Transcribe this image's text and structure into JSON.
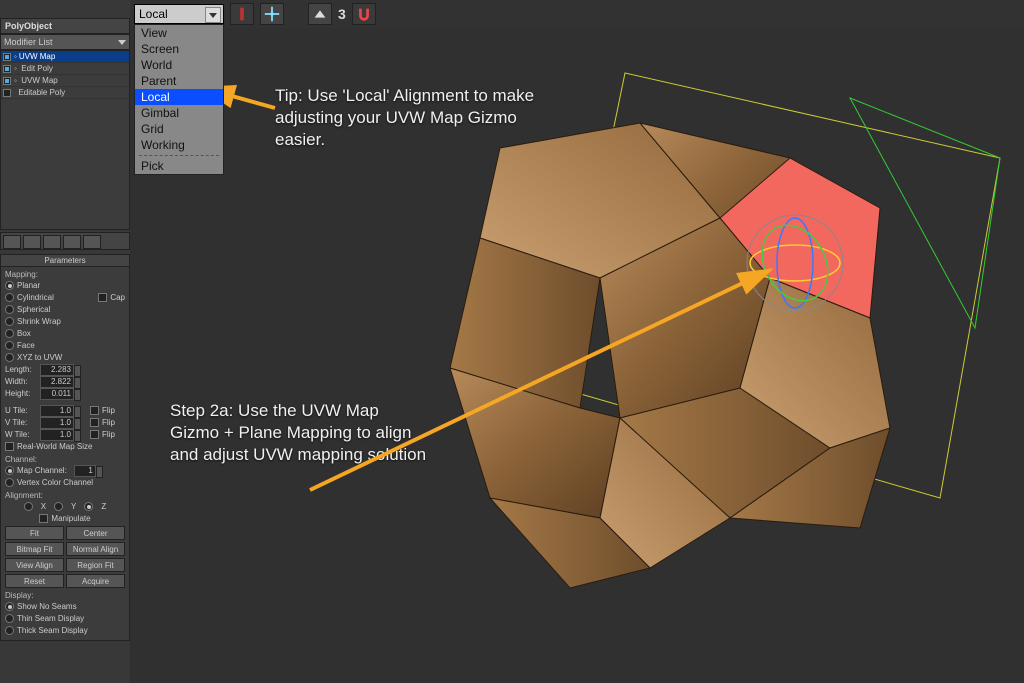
{
  "top": {
    "object_name": "PolyObject",
    "modifier_list_label": "Modifier List",
    "stack": [
      {
        "label": "UVW Map",
        "selected": true,
        "on": true
      },
      {
        "label": "Edit Poly",
        "selected": false,
        "on": true
      },
      {
        "label": "UVW Map",
        "selected": false,
        "on": true
      },
      {
        "label": "Editable Poly",
        "selected": false,
        "on": false
      }
    ]
  },
  "params": {
    "title": "Parameters",
    "mapping_label": "Mapping:",
    "mapping_options": {
      "planar": "Planar",
      "cylindrical": "Cylindrical",
      "cap": "Cap",
      "spherical": "Spherical",
      "shrink": "Shrink Wrap",
      "box": "Box",
      "face": "Face",
      "xyz": "XYZ to UVW"
    },
    "length_label": "Length:",
    "length_value": "2.283",
    "width_label": "Width:",
    "width_value": "2.822",
    "height_label": "Height:",
    "height_value": "0.011",
    "utile_label": "U Tile:",
    "utile_value": "1.0",
    "vtile_label": "V Tile:",
    "vtile_value": "1.0",
    "wtile_label": "W Tile:",
    "wtile_value": "1.0",
    "flip_label": "Flip",
    "realworld_label": "Real-World Map Size",
    "channel_label": "Channel:",
    "map_channel_label": "Map Channel:",
    "map_channel_value": "1",
    "vertex_color_label": "Vertex Color Channel",
    "alignment_label": "Alignment:",
    "x": "X",
    "y": "Y",
    "z": "Z",
    "manipulate": "Manipulate",
    "fit": "Fit",
    "center": "Center",
    "bitmap": "Bitmap Fit",
    "normal": "Normal Align",
    "viewalign": "View Align",
    "region": "Region Fit",
    "reset": "Reset",
    "acquire": "Acquire",
    "display_label": "Display:",
    "show_no_seams": "Show No Seams",
    "thin_seam": "Thin Seam Display",
    "thick_seam": "Thick Seam Display"
  },
  "coord": {
    "selected": "Local",
    "options": [
      "View",
      "Screen",
      "World",
      "Parent",
      "Local",
      "Gimbal",
      "Grid",
      "Working"
    ],
    "pick": "Pick"
  },
  "anno": {
    "tip": "Tip: Use 'Local' Alignment to make adjusting your UVW Map Gizmo easier.",
    "step": "Step 2a: Use the UVW Map Gizmo + Plane Mapping to align and adjust UVW mapping solution"
  },
  "toolbar_number": "3"
}
